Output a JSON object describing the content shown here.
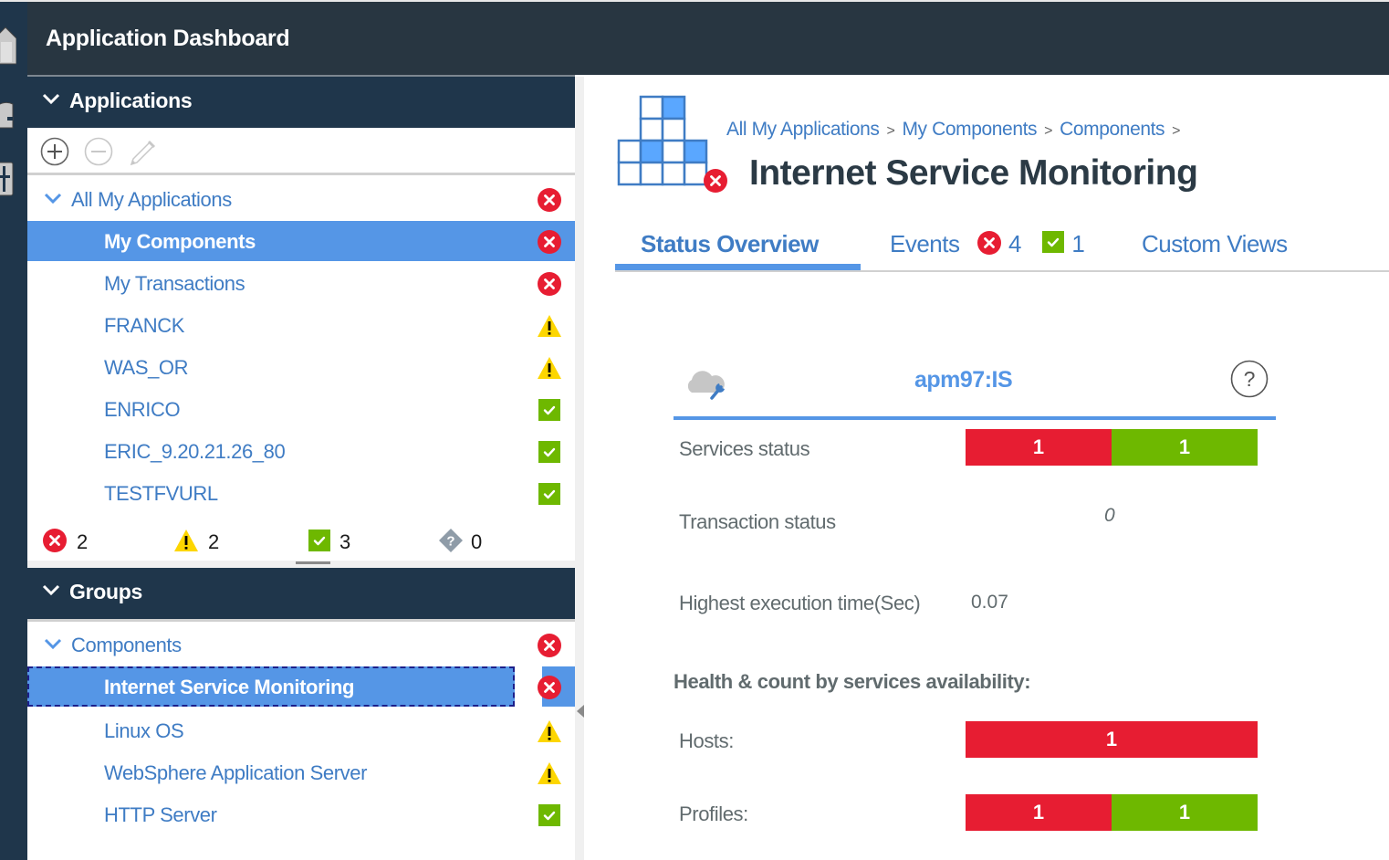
{
  "header": {
    "title": "Application Dashboard"
  },
  "rail": {
    "icons": [
      "home-icon",
      "dashboard-gauge-icon",
      "tools-icon"
    ]
  },
  "colors": {
    "critical": "#e71d32",
    "warning": "#fdd600",
    "normal": "#6eb800",
    "unknown": "#8f9ca8",
    "accent": "#5596e6",
    "link": "#3f7cc4",
    "header_bg": "#283641",
    "panel_bg": "#1f364b"
  },
  "applications": {
    "title": "Applications",
    "toolbar": {
      "add": "add-icon",
      "remove": "remove-icon",
      "edit": "edit-pencil-icon"
    },
    "root": {
      "label": "All My Applications",
      "status": "critical"
    },
    "items": [
      {
        "label": "My Components",
        "status": "critical",
        "selected": true
      },
      {
        "label": "My Transactions",
        "status": "critical"
      },
      {
        "label": "FRANCK",
        "status": "warning"
      },
      {
        "label": "WAS_OR",
        "status": "warning"
      },
      {
        "label": "ENRICO",
        "status": "normal"
      },
      {
        "label": "ERIC_9.20.21.26_80",
        "status": "normal"
      },
      {
        "label": "TESTFVURL",
        "status": "normal"
      }
    ],
    "summary": {
      "critical": "2",
      "warning": "2",
      "normal": "3",
      "unknown": "0"
    }
  },
  "groups": {
    "title": "Groups",
    "root": {
      "label": "Components",
      "status": "critical"
    },
    "items": [
      {
        "label": "Internet Service Monitoring",
        "status": "critical",
        "selected": true
      },
      {
        "label": "Linux OS",
        "status": "warning"
      },
      {
        "label": "WebSphere Application Server",
        "status": "warning"
      },
      {
        "label": "HTTP Server",
        "status": "normal"
      }
    ]
  },
  "main": {
    "breadcrumb": [
      "All My Applications",
      "My Components",
      "Components"
    ],
    "breadcrumb_sep": ">",
    "title": "Internet Service Monitoring",
    "title_status": "critical",
    "tabs": [
      {
        "label": "Status Overview",
        "active": true
      },
      {
        "label": "Events",
        "critical_count": "4",
        "normal_count": "1"
      },
      {
        "label": "Custom Views"
      }
    ],
    "card": {
      "title": "apm97:IS",
      "services_status": {
        "label": "Services status",
        "critical": 1,
        "normal": 1
      },
      "transaction_status": {
        "label": "Transaction status",
        "value": "0"
      },
      "highest_exec": {
        "label": "Highest execution time(Sec)",
        "value": "0.07"
      },
      "health_title": "Health & count by services availability:",
      "hosts": {
        "label": "Hosts:",
        "critical": 1,
        "normal": 0
      },
      "profiles": {
        "label": "Profiles:",
        "critical": 1,
        "normal": 1
      }
    }
  }
}
